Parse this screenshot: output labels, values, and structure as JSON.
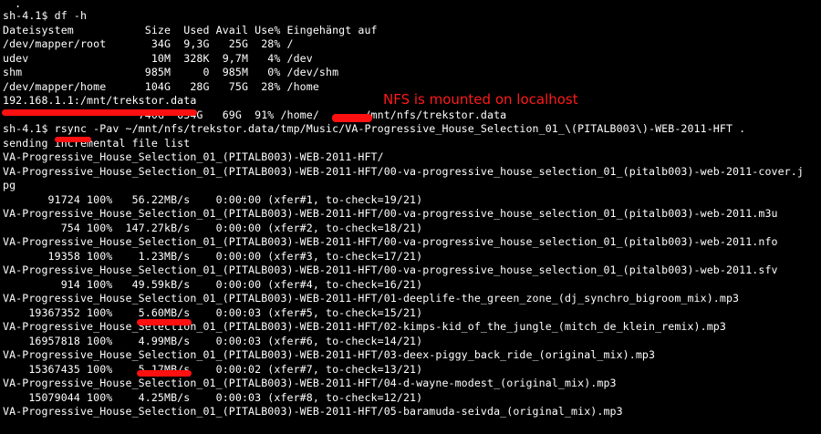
{
  "terminal": {
    "top_fragment": ".",
    "lines": [
      "sh-4.1$ df -h",
      "Dateisystem           Size  Used Avail Use% Eingehängt auf",
      "/dev/mapper/root       34G  9,3G   25G  28% /",
      "udev                   10M  328K  9,7M   4% /dev",
      "shm                   985M     0  985M   0% /dev/shm",
      "/dev/mapper/home      104G   28G   75G  28% /home",
      "192.168.1.1:/mnt/trekstor.data",
      "                     740G  634G   69G  91% /home/       /mnt/nfs/trekstor.data",
      "sh-4.1$ rsync -Pav ~/mnt/nfs/trekstor.data/tmp/Music/VA-Progressive_House_Selection_01_\\(PITALB003\\)-WEB-2011-HFT .",
      "sending incremental file list",
      "VA-Progressive_House_Selection_01_(PITALB003)-WEB-2011-HFT/",
      "VA-Progressive_House_Selection_01_(PITALB003)-WEB-2011-HFT/00-va-progressive_house_selection_01_(pitalb003)-web-2011-cover.j",
      "pg",
      "       91724 100%   56.22MB/s    0:00:00 (xfer#1, to-check=19/21)",
      "VA-Progressive_House_Selection_01_(PITALB003)-WEB-2011-HFT/00-va-progressive_house_selection_01_(pitalb003)-web-2011.m3u",
      "         754 100%  147.27kB/s    0:00:00 (xfer#2, to-check=18/21)",
      "VA-Progressive_House_Selection_01_(PITALB003)-WEB-2011-HFT/00-va-progressive_house_selection_01_(pitalb003)-web-2011.nfo",
      "       19358 100%    1.23MB/s    0:00:00 (xfer#3, to-check=17/21)",
      "VA-Progressive_House_Selection_01_(PITALB003)-WEB-2011-HFT/00-va-progressive_house_selection_01_(pitalb003)-web-2011.sfv",
      "         914 100%   49.59kB/s    0:00:00 (xfer#4, to-check=16/21)",
      "VA-Progressive_House_Selection_01_(PITALB003)-WEB-2011-HFT/01-deeplife-the_green_zone_(dj_synchro_bigroom_mix).mp3",
      "    19367352 100%    5.60MB/s    0:00:03 (xfer#5, to-check=15/21)",
      "VA-Progressive_House_Selection_01_(PITALB003)-WEB-2011-HFT/02-kimps-kid_of_the_jungle_(mitch_de_klein_remix).mp3",
      "    16957818 100%    4.99MB/s    0:00:03 (xfer#6, to-check=14/21)",
      "VA-Progressive_House_Selection_01_(PITALB003)-WEB-2011-HFT/03-deex-piggy_back_ride_(original_mix).mp3",
      "    15367435 100%    5.17MB/s    0:00:02 (xfer#7, to-check=13/21)",
      "VA-Progressive_House_Selection_01_(PITALB003)-WEB-2011-HFT/04-d-wayne-modest_(original_mix).mp3",
      "    15079044 100%    4.25MB/s    0:00:03 (xfer#8, to-check=12/21)",
      "VA-Progressive_House_Selection_01_(PITALB003)-WEB-2011-HFT/05-baramuda-seivda_(original_mix).mp3"
    ]
  },
  "annotation": {
    "text": "NFS is mounted on localhost"
  },
  "colors": {
    "terminal_bg": "#000000",
    "terminal_fg": "#ffffff",
    "highlight_red": "#ff1010"
  }
}
